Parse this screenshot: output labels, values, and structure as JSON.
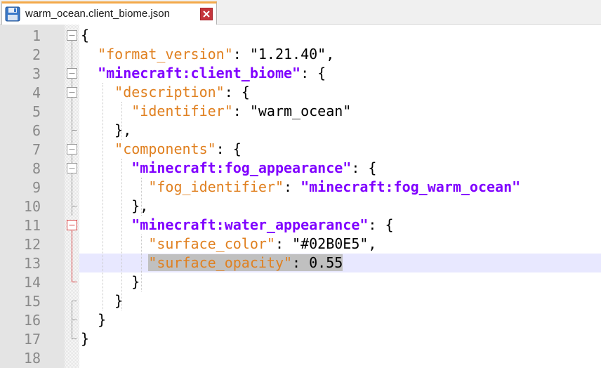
{
  "tab": {
    "title": "warm_ocean.client_biome.json",
    "icon": "save-disk-icon",
    "close_icon": "close-icon"
  },
  "colors": {
    "key": "#e08020",
    "bold_key": "#8000ff",
    "current_line": "#e8e8ff",
    "fold_active": "#d84040"
  },
  "lines": [
    {
      "num": "1",
      "indent": "",
      "tokens": [
        {
          "t": "{",
          "c": "p"
        }
      ]
    },
    {
      "num": "2",
      "indent": "  ",
      "tokens": [
        {
          "t": "\"format_version\"",
          "c": "k"
        },
        {
          "t": ": ",
          "c": "p"
        },
        {
          "t": "\"1.21.40\"",
          "c": "s"
        },
        {
          "t": ",",
          "c": "p"
        }
      ]
    },
    {
      "num": "3",
      "indent": "  ",
      "tokens": [
        {
          "t": "\"minecraft:client_biome\"",
          "c": "kb"
        },
        {
          "t": ": {",
          "c": "p"
        }
      ]
    },
    {
      "num": "4",
      "indent": "    ",
      "tokens": [
        {
          "t": "\"description\"",
          "c": "k"
        },
        {
          "t": ": {",
          "c": "p"
        }
      ]
    },
    {
      "num": "5",
      "indent": "      ",
      "tokens": [
        {
          "t": "\"identifier\"",
          "c": "k"
        },
        {
          "t": ": ",
          "c": "p"
        },
        {
          "t": "\"warm_ocean\"",
          "c": "s"
        }
      ]
    },
    {
      "num": "6",
      "indent": "    ",
      "tokens": [
        {
          "t": "},",
          "c": "p"
        }
      ]
    },
    {
      "num": "7",
      "indent": "    ",
      "tokens": [
        {
          "t": "\"components\"",
          "c": "k"
        },
        {
          "t": ": {",
          "c": "p"
        }
      ]
    },
    {
      "num": "8",
      "indent": "      ",
      "tokens": [
        {
          "t": "\"minecraft:fog_appearance\"",
          "c": "kb"
        },
        {
          "t": ": {",
          "c": "p"
        }
      ]
    },
    {
      "num": "9",
      "indent": "        ",
      "tokens": [
        {
          "t": "\"fog_identifier\"",
          "c": "k"
        },
        {
          "t": ": ",
          "c": "p"
        },
        {
          "t": "\"minecraft:fog_warm_ocean\"",
          "c": "sb"
        }
      ]
    },
    {
      "num": "10",
      "indent": "      ",
      "tokens": [
        {
          "t": "},",
          "c": "p"
        }
      ]
    },
    {
      "num": "11",
      "indent": "      ",
      "tokens": [
        {
          "t": "\"minecraft:water_appearance\"",
          "c": "kb"
        },
        {
          "t": ": {",
          "c": "p"
        }
      ]
    },
    {
      "num": "12",
      "indent": "        ",
      "tokens": [
        {
          "t": "\"surface_color\"",
          "c": "k"
        },
        {
          "t": ": ",
          "c": "p"
        },
        {
          "t": "\"#02B0E5\"",
          "c": "s"
        },
        {
          "t": ",",
          "c": "p"
        }
      ]
    },
    {
      "num": "13",
      "indent": "        ",
      "tokens": [
        {
          "t": "\"surface_opacity\"",
          "c": "k",
          "sel": true
        },
        {
          "t": ": 0.55",
          "c": "p",
          "sel": true
        }
      ],
      "current": true
    },
    {
      "num": "14",
      "indent": "      ",
      "tokens": [
        {
          "t": "}",
          "c": "p"
        }
      ]
    },
    {
      "num": "15",
      "indent": "    ",
      "tokens": [
        {
          "t": "}",
          "c": "p"
        }
      ]
    },
    {
      "num": "16",
      "indent": "  ",
      "tokens": [
        {
          "t": "}",
          "c": "p"
        }
      ]
    },
    {
      "num": "17",
      "indent": "",
      "tokens": [
        {
          "t": "}",
          "c": "p"
        }
      ]
    },
    {
      "num": "18",
      "indent": "",
      "tokens": []
    }
  ],
  "folds": [
    {
      "line": 1,
      "type": "open"
    },
    {
      "line": 3,
      "type": "open"
    },
    {
      "line": 4,
      "type": "open"
    },
    {
      "line": 6,
      "type": "end"
    },
    {
      "line": 7,
      "type": "open"
    },
    {
      "line": 8,
      "type": "open"
    },
    {
      "line": 10,
      "type": "end"
    },
    {
      "line": 11,
      "type": "open-active"
    },
    {
      "line": 14,
      "type": "end-active"
    },
    {
      "line": 15,
      "type": "end"
    },
    {
      "line": 16,
      "type": "end"
    },
    {
      "line": 17,
      "type": "last"
    }
  ]
}
